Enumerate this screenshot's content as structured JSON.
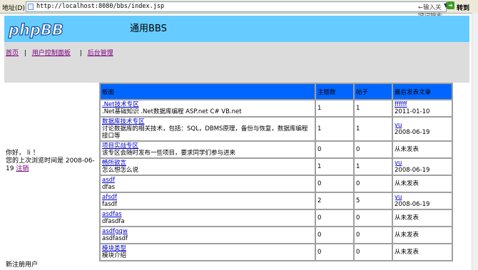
{
  "browser": {
    "address_label": "地址(D)",
    "url": "http://localhost:8080/bbs/index.jsp",
    "search_placeholder": "←输入关键词搜索",
    "go_label": "转到"
  },
  "header": {
    "logo_text": "phpBB",
    "site_title": "通用BBS"
  },
  "nav": {
    "home": "首页",
    "user_panel": "用户控制面板",
    "admin": "后台管理",
    "separator": "|"
  },
  "user": {
    "greeting": "你好，  li  ！",
    "last_visit": "您的上次浏览时间是  2008-06-19",
    "logout": "注销",
    "register": "新注册用户"
  },
  "table": {
    "headers": [
      "板面",
      "主题数",
      "帖子",
      "最后发表文章"
    ],
    "rows": [
      {
        "name": ".Net技术专区",
        "desc": ".Net基础知识 .Net数据库编程 ASP.net C# VB.net",
        "topics": "1",
        "posts": "1",
        "last_user": "ffffff",
        "last_date": "2011-01-10"
      },
      {
        "name": "数据库技术专区",
        "desc": "讨论数据库的相关技术，包括：SQL，DBMS原理，备份与恢复，数据库编程接口等",
        "topics": "1",
        "posts": "1",
        "last_user": "yu",
        "last_date": "2008-06-19"
      },
      {
        "name": "项目实战专区",
        "desc": "该专区会随时发布一些项目，要求同学们参与进来",
        "topics": "0",
        "posts": "0",
        "last_user": "",
        "last_date": "",
        "last_text": "从未发表"
      },
      {
        "name": "畅所欲言",
        "desc": "怎么想怎么说",
        "topics": "1",
        "posts": "1",
        "last_user": "yu",
        "last_date": "2008-06-19"
      },
      {
        "name": "asdf",
        "desc": "dfas",
        "topics": "0",
        "posts": "0",
        "last_user": "",
        "last_date": "",
        "last_text": "从未发表"
      },
      {
        "name": "afsdf",
        "desc": "fasdf",
        "topics": "2",
        "posts": "5",
        "last_user": "yu",
        "last_date": "2008-06-19"
      },
      {
        "name": "asdfas",
        "desc": "dfasdfa",
        "topics": "0",
        "posts": "0",
        "last_user": "",
        "last_date": "",
        "last_text": "从未发表"
      },
      {
        "name": "asdfgqw",
        "desc": "asdfasdf",
        "topics": "0",
        "posts": "0",
        "last_user": "",
        "last_date": "",
        "last_text": "从未发表"
      },
      {
        "name": "模块类型",
        "desc": "模块介绍",
        "topics": "0",
        "posts": "0",
        "last_user": "",
        "last_date": "",
        "last_text": "从未发表"
      }
    ]
  },
  "colors": {
    "banner": "#66ccff",
    "table_header": "#0066ff",
    "navbar": "#dcdcdc",
    "visited_link": "#800080"
  }
}
